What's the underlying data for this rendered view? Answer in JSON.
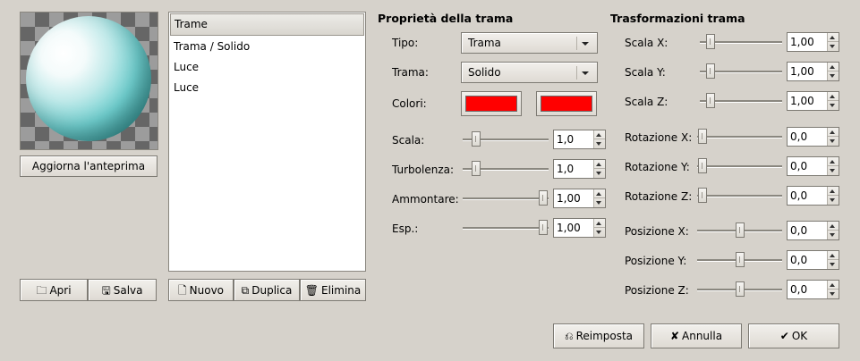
{
  "preview": {
    "refresh_button": "Aggiorna l'anteprima"
  },
  "file_buttons": {
    "open": "Apri",
    "save": "Salva"
  },
  "list": {
    "header": "Trame",
    "items": [
      "Trama / Solido",
      "Luce",
      "Luce"
    ]
  },
  "list_buttons": {
    "new": "Nuovo",
    "duplicate": "Duplica",
    "delete": "Elimina"
  },
  "properties": {
    "title": "Proprietà della trama",
    "tipo_label": "Tipo:",
    "tipo_value": "Trama",
    "trama_label": "Trama:",
    "trama_value": "Solido",
    "colori_label": "Colori:",
    "color1": "#ff0000",
    "color2": "#ff0000",
    "scala_label": "Scala:",
    "scala_value": "1,0",
    "turbolenza_label": "Turbolenza:",
    "turbolenza_value": "1,0",
    "ammontare_label": "Ammontare:",
    "ammontare_value": "1,00",
    "esp_label": "Esp.:",
    "esp_value": "1,00"
  },
  "transform": {
    "title": "Trasformazioni trama",
    "scale_x_label": "Scala X:",
    "scale_x_value": "1,00",
    "scale_y_label": "Scala Y:",
    "scale_y_value": "1,00",
    "scale_z_label": "Scala Z:",
    "scale_z_value": "1,00",
    "rot_x_label": "Rotazione X:",
    "rot_x_value": "0,0",
    "rot_y_label": "Rotazione Y:",
    "rot_y_value": "0,0",
    "rot_z_label": "Rotazione Z:",
    "rot_z_value": "0,0",
    "pos_x_label": "Posizione X:",
    "pos_x_value": "0,0",
    "pos_y_label": "Posizione Y:",
    "pos_y_value": "0,0",
    "pos_z_label": "Posizione Z:",
    "pos_z_value": "0,0"
  },
  "dialog_buttons": {
    "reset": "Reimposta",
    "cancel": "Annulla",
    "ok": "OK"
  }
}
